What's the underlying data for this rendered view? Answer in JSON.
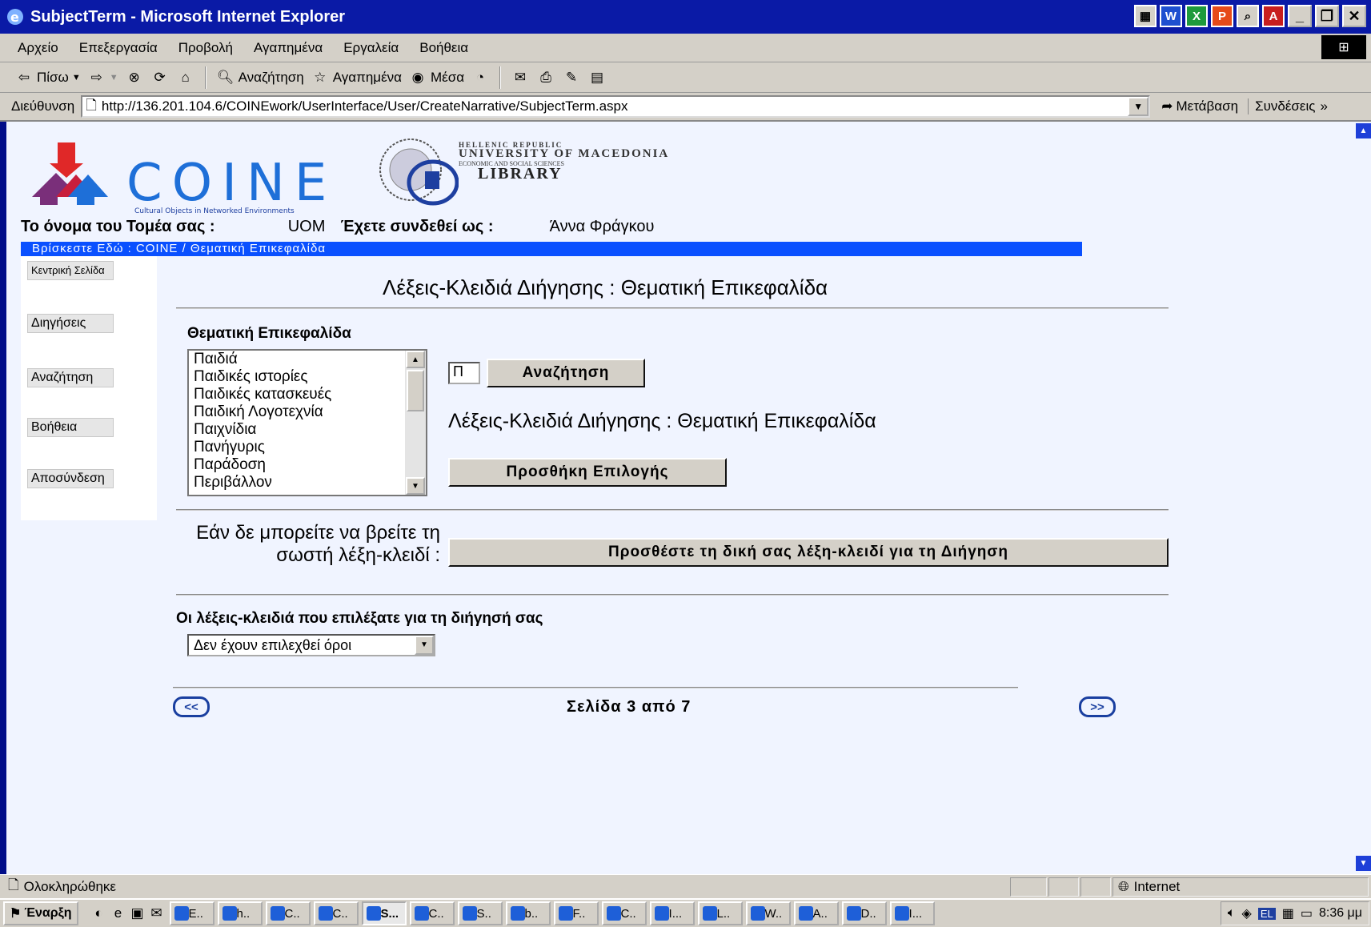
{
  "window": {
    "title": "SubjectTerm - Microsoft Internet Explorer"
  },
  "menu": [
    "Αρχείο",
    "Επεξεργασία",
    "Προβολή",
    "Αγαπημένα",
    "Εργαλεία",
    "Βοήθεια"
  ],
  "toolbar": {
    "back": "Πίσω",
    "search": "Αναζήτηση",
    "favorites": "Αγαπημένα",
    "media": "Μέσα"
  },
  "address": {
    "label": "Διεύθυνση",
    "url": "http://136.201.104.6/COINEwork/UserInterface/User/CreateNarrative/SubjectTerm.aspx",
    "go": "Μετάβαση",
    "links": "Συνδέσεις"
  },
  "header": {
    "logo_text": "COINE",
    "logo_sub": "Cultural Objects in Networked Environments",
    "library_l1": "HELLENIC REPUBLIC",
    "library_l2": "UNIVERSITY OF MACEDONIA",
    "library_l3": "ECONOMIC AND SOCIAL SCIENCES",
    "library_l4": "LIBRARY",
    "sector_label": "Το όνομα του Τομέα σας :",
    "sector_value": "UOM",
    "user_label": "Έχετε συνδεθεί ως :",
    "user_value": "Άννα Φράγκου",
    "breadcrumb": "Βρίσκεστε Εδώ : COINE / Θεματική Επικεφαλίδα"
  },
  "nav": [
    "Κεντρική Σελίδα",
    "Διηγήσεις",
    "Αναζήτηση",
    "Βοήθεια",
    "Αποσύνδεση"
  ],
  "main": {
    "heading": "Λέξεις-Κλειδιά Διήγησης : Θεματική Επικεφαλίδα",
    "subject_label": "Θεματική Επικεφαλίδα",
    "list_items": [
      "Παιδιά",
      "Παιδικές ιστορίες",
      "Παιδικές κατασκευές",
      "Παιδική Λογοτεχνία",
      "Παιχνίδια",
      "Πανήγυρις",
      "Παράδοση",
      "Περιβάλλον"
    ],
    "search_value": "Π",
    "search_button": "Αναζήτηση",
    "selection_label": "Λέξεις-Κλειδιά Διήγησης : Θεματική Επικεφαλίδα",
    "add_selection_button": "Προσθήκη Επιλογής",
    "not_found_text": "Εάν δε μπορείτε να βρείτε τη σωστή λέξη-κλειδί :",
    "add_own_button": "Προσθέστε τη δική σας λέξη-κλειδί για τη Διήγηση",
    "chosen_label": "Οι λέξεις-κλειδιά που επιλέξατε για τη διήγησή σας",
    "chosen_select": "Δεν έχουν επιλεχθεί όροι",
    "prev": "<<",
    "next": ">>",
    "page_text": "Σελίδα 3  από   7"
  },
  "status": {
    "text": "Ολοκληρώθηκε",
    "zone": "Internet"
  },
  "taskbar": {
    "start": "Έναρξη",
    "tasks": [
      "E..",
      "h..",
      "C..",
      "C..",
      "S...",
      "C..",
      "S..",
      "b..",
      "F..",
      "C..",
      "I...",
      "L..",
      "W..",
      "A..",
      "D..",
      "I..."
    ],
    "lang": "EL",
    "clock": "8:36 μμ"
  },
  "colors": {
    "title_bar": "#0a1aa6",
    "breadcrumb": "#0a50ff",
    "page_bg": "#f0f4ff",
    "chrome": "#d4d0c8"
  }
}
